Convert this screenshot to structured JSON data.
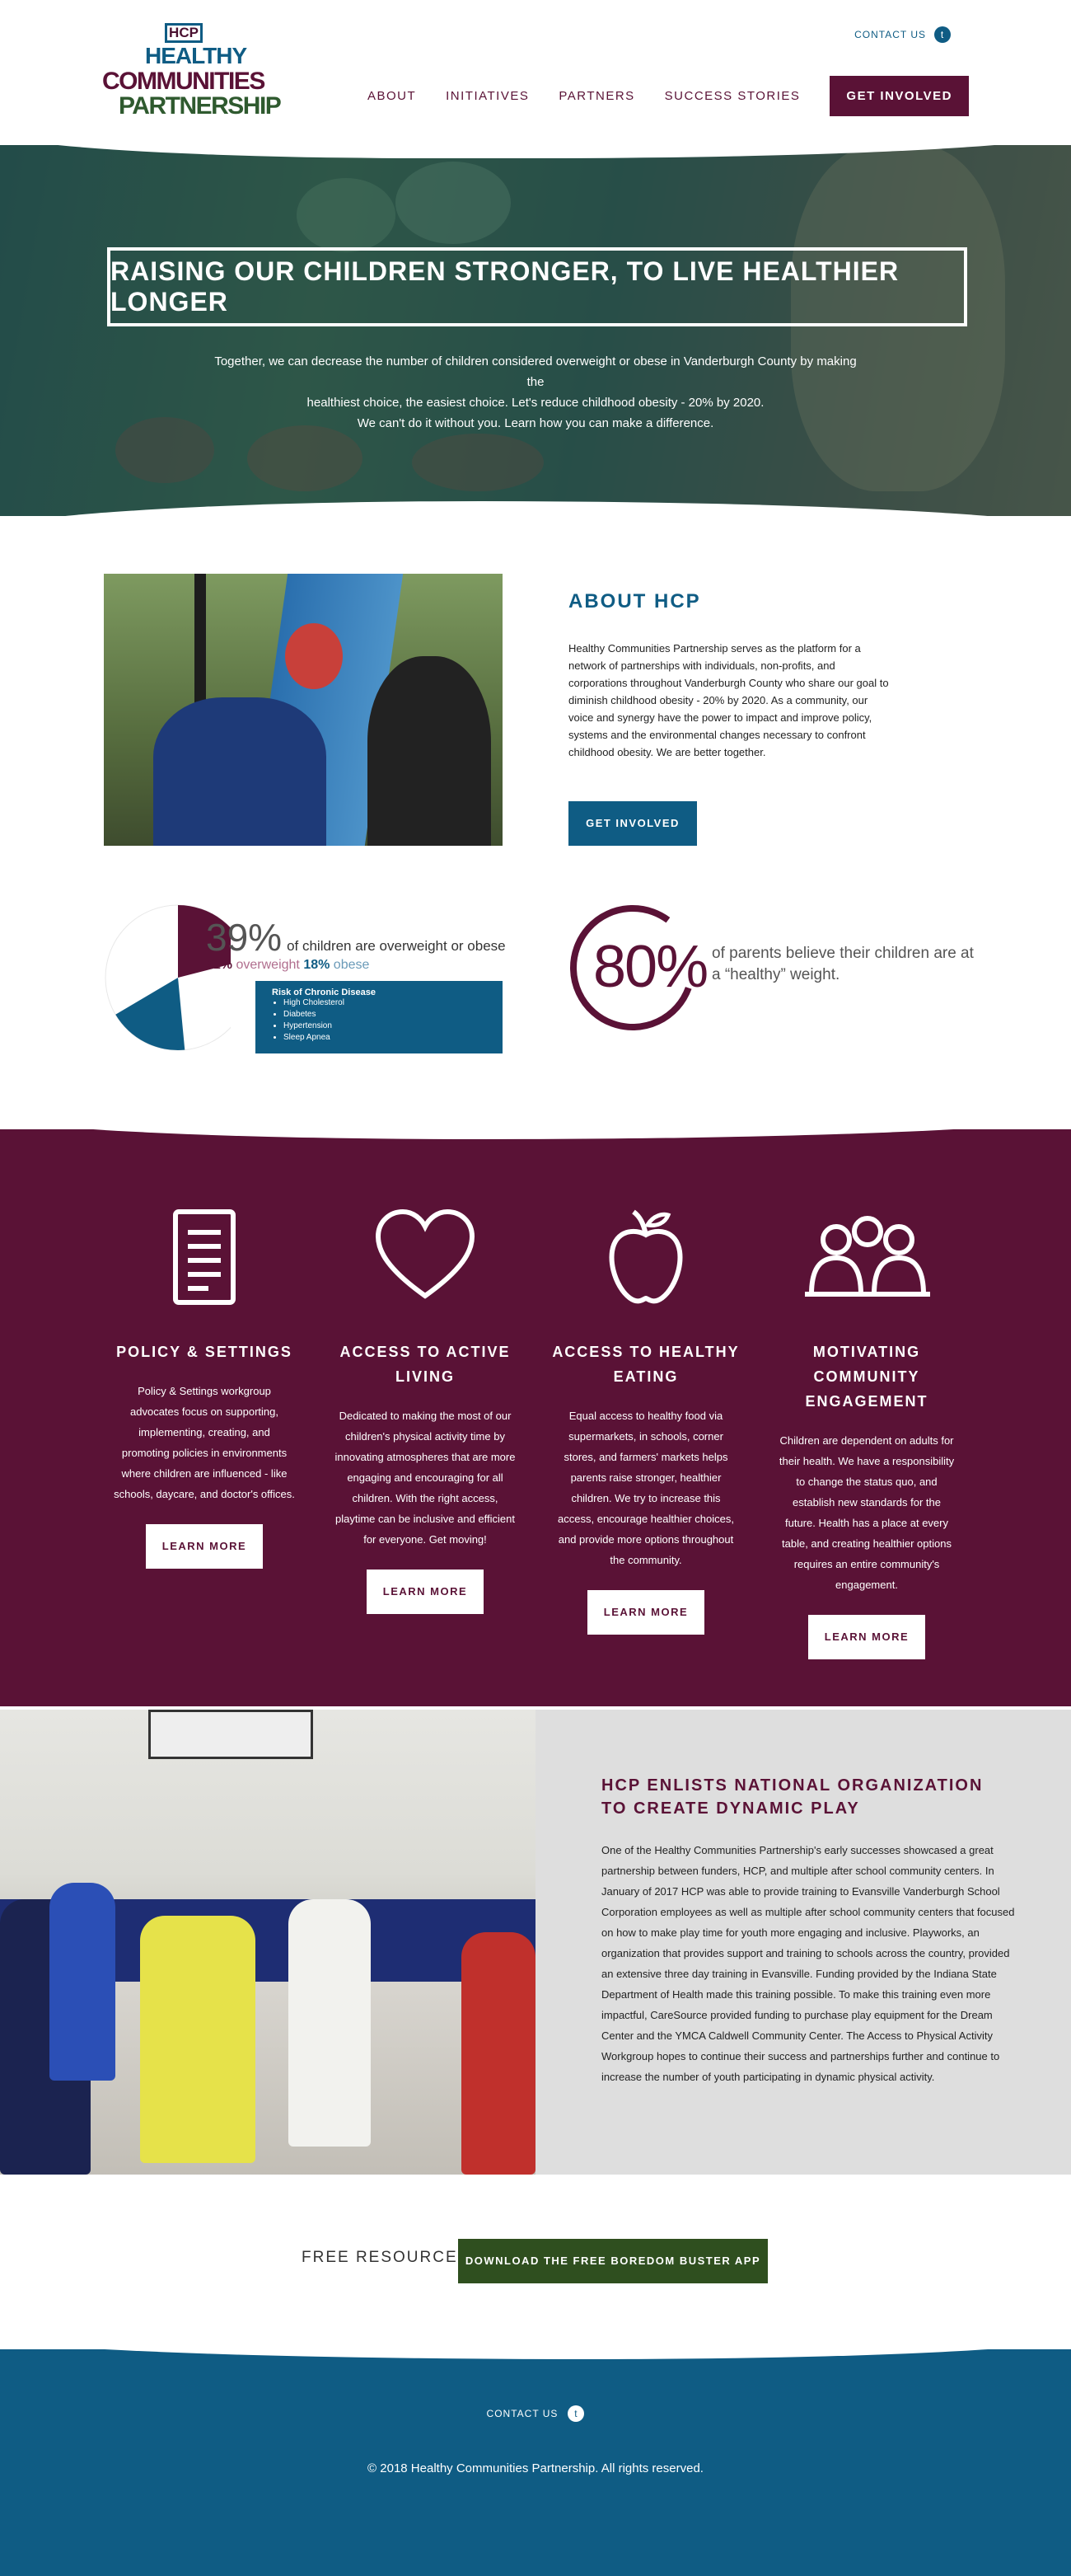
{
  "header": {
    "logo": {
      "badge": "HCP",
      "line1": "HEALTHY",
      "line2": "COMMUNITIES",
      "line3": "PARTNERSHIP"
    },
    "contact_label": "CONTACT US",
    "nav": [
      "ABOUT",
      "INITIATIVES",
      "PARTNERS",
      "SUCCESS STORIES"
    ],
    "cta": "GET INVOLVED"
  },
  "hero": {
    "title": "RAISING OUR CHILDREN STRONGER, TO LIVE HEALTHIER LONGER",
    "line1": "Together, we can decrease the number of children considered overweight or obese in Vanderburgh County by making the",
    "line2": "healthiest choice, the easiest choice. Let's reduce childhood obesity - 20% by 2020.",
    "line3": "We can't do it without you. Learn how you can make a difference."
  },
  "about": {
    "title": "ABOUT HCP",
    "text": "Healthy Communities Partnership serves as the platform for a network of partnerships with individuals, non-profits, and corporations throughout Vanderburgh County who share our goal to diminish childhood obesity - 20% by 2020. As a community, our voice and synergy have the power to impact and improve policy, systems and the environmental changes necessary to confront childhood obesity. We are better together.",
    "button": "GET INVOLVED"
  },
  "stats": {
    "big_pct": "39%",
    "big_text": "of children are overweight or obese",
    "overweight_pct": "21%",
    "overweight_label": "overweight",
    "obese_pct": "18%",
    "obese_label": "obese",
    "risk_title": "Risk of Chronic Disease",
    "risks": [
      "High Cholesterol",
      "Diabetes",
      "Hypertension",
      "Sleep Apnea"
    ],
    "parents_pct": "80%",
    "parents_text": "of parents believe their children are at a “healthy” weight.",
    "pie": {
      "overweight": 21,
      "obese": 18
    },
    "colors": {
      "overweight": "#5a1236",
      "obese": "#0f5c84",
      "rest": "#ffffff"
    }
  },
  "initiatives": [
    {
      "icon": "document-icon",
      "title": "POLICY & SETTINGS",
      "text": "Policy & Settings workgroup advocates focus on supporting, implementing, creating, and promoting policies in environments where children are influenced - like schools, daycare, and doctor's offices.",
      "button": "LEARN MORE"
    },
    {
      "icon": "heart-icon",
      "title": "ACCESS TO ACTIVE LIVING",
      "text": "Dedicated to making the most of our children's physical activity time by innovating atmospheres that are more engaging and encouraging for all children. With the right access, playtime can be inclusive and efficient for everyone. Get moving!",
      "button": "LEARN MORE"
    },
    {
      "icon": "apple-icon",
      "title": "ACCESS TO HEALTHY EATING",
      "text": "Equal access to healthy food via supermarkets, in schools, corner stores, and farmers' markets helps parents raise stronger, healthier children. We try to increase this access, encourage healthier choices, and provide more options throughout the community.",
      "button": "LEARN MORE"
    },
    {
      "icon": "people-icon",
      "title": "MOTIVATING COMMUNITY ENGAGEMENT",
      "text": "Children are dependent on adults for their health. We have a responsibility to change the status quo, and establish new standards for the future. Health has a place at every table, and creating healthier options requires an entire community's engagement.",
      "button": "LEARN MORE"
    }
  ],
  "dynamic": {
    "title": "HCP ENLISTS NATIONAL ORGANIZATION TO CREATE DYNAMIC PLAY",
    "text": "One of the Healthy Communities Partnership's early successes showcased a great partnership between funders, HCP, and multiple after school community centers. In January of 2017 HCP was able to provide training to Evansville Vanderburgh School Corporation employees as well as multiple after school community centers that focused on how to make play time for youth more engaging and inclusive. Playworks, an organization that provides support and training to schools across the country, provided an extensive three day training in Evansville. Funding provided by the Indiana State Department of Health made this training possible. To make this training even more impactful, CareSource provided funding to purchase play equipment for the Dream Center and the YMCA Caldwell Community Center. The Access to Physical Activity Workgroup hopes to continue their success and partnerships further and continue to increase the number of youth participating in dynamic physical activity."
  },
  "resource": {
    "label": "FREE RESOURCE:",
    "button": "DOWNLOAD THE FREE BOREDOM BUSTER APP"
  },
  "footer": {
    "contact_label": "CONTACT US",
    "copyright": "© 2018 Healthy Communities Partnership. All rights reserved."
  }
}
